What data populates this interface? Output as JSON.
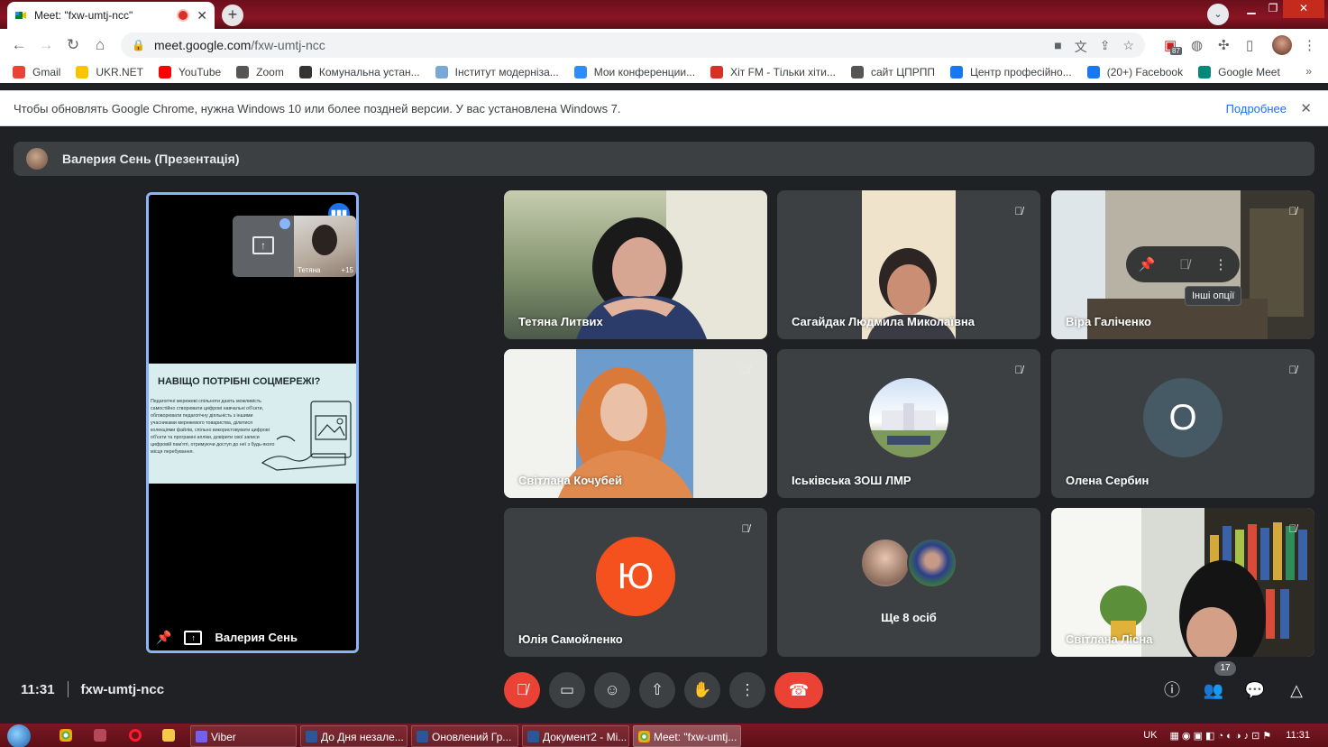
{
  "browser": {
    "tab_title": "Meet: \"fxw-umtj-ncc\"",
    "tab_close": "✕",
    "new_tab": "+",
    "url_host": "meet.google.com",
    "url_path": "/fxw-umtj-ncc",
    "extension_badge": "87"
  },
  "bookmarks": [
    {
      "label": "Gmail",
      "icon": "gmail-icon",
      "color": "#ea4335"
    },
    {
      "label": "UKR.NET",
      "icon": "ukrnet-icon",
      "color": "#f9c400"
    },
    {
      "label": "YouTube",
      "icon": "youtube-icon",
      "color": "#ff0000"
    },
    {
      "label": "Zoom",
      "icon": "zoom-icon",
      "color": "#555555"
    },
    {
      "label": "Комунальна устан...",
      "icon": "wordpress-icon",
      "color": "#333333"
    },
    {
      "label": "Інститут модерніза...",
      "icon": "institute-icon",
      "color": "#7aa7d8"
    },
    {
      "label": "Мои конференции...",
      "icon": "zoom-z-icon",
      "color": "#2d8cff"
    },
    {
      "label": "Хіт FM - Тільки хіти...",
      "icon": "hitfm-icon",
      "color": "#d93025"
    },
    {
      "label": "сайт ЦПРПП",
      "icon": "globe-icon",
      "color": "#555555"
    },
    {
      "label": "Центр професійно...",
      "icon": "facebook-icon",
      "color": "#1877f2"
    },
    {
      "label": "(20+) Facebook",
      "icon": "facebook-icon",
      "color": "#1877f2"
    },
    {
      "label": "Google Meet",
      "icon": "meet-icon",
      "color": "#00897b"
    }
  ],
  "bookmarks_more": "»",
  "infobar": {
    "message": "Чтобы обновлять Google Chrome, нужна Windows 10 или более поздней версии. У вас установлена Windows 7.",
    "link": "Подробнее",
    "close": "✕"
  },
  "meet": {
    "presenter_banner": "Валерия Сень (Презентація)",
    "presentation_tile": {
      "name": "Валерия Сень",
      "mini_label": "Тетяна",
      "mini_count": "+15",
      "slide_title": "НАВІЩО ПОТРІБНІ СОЦМЕРЕЖІ?",
      "slide_body": "Педагогічні мережеві спільноти дають можливість самостійно створювати цифрові навчальні об'єкти, обговорювати педагогічну діяльність з іншими учасниками мережевого товариства, ділитися колекціями файлів, спільно використовувати цифрові об'єкти та програмні апліки, довірити свої записи цифровій пам'яті, отримуючи доступ до неї з будь-якого місця перебування."
    },
    "tiles": [
      {
        "name": "Тетяна Литвих",
        "type": "video",
        "muted": false
      },
      {
        "name": "Сагайдак Людмила Миколаївна",
        "type": "video",
        "muted": true
      },
      {
        "name": "Віра Галіченко",
        "type": "video",
        "muted": true,
        "hover": true
      },
      {
        "name": "Світлана Кочубей",
        "type": "video",
        "muted": true
      },
      {
        "name": "Іськівська ЗОШ ЛМР",
        "type": "image-avatar",
        "muted": true
      },
      {
        "name": "Олена Сербин",
        "type": "letter",
        "letter": "О",
        "color": "#455a64",
        "muted": true
      },
      {
        "name": "Юлія Самойленко",
        "type": "letter",
        "letter": "Ю",
        "color": "#f4511e",
        "muted": true
      },
      {
        "name": "Ще 8 осіб",
        "type": "group"
      },
      {
        "name": "Світлана Лісна",
        "type": "video",
        "muted": true
      }
    ],
    "hover_tooltip": "Інші опції",
    "time": "11:31",
    "meeting_code": "fxw-umtj-ncc",
    "participant_count": "17"
  },
  "taskbar": {
    "buttons": [
      "Viber",
      "До Дня незале...",
      "Оновлений Гр...",
      "Документ2 - Mi...",
      "Meet: \"fxw-umtj..."
    ],
    "lang": "UK",
    "clock": "11:31"
  }
}
